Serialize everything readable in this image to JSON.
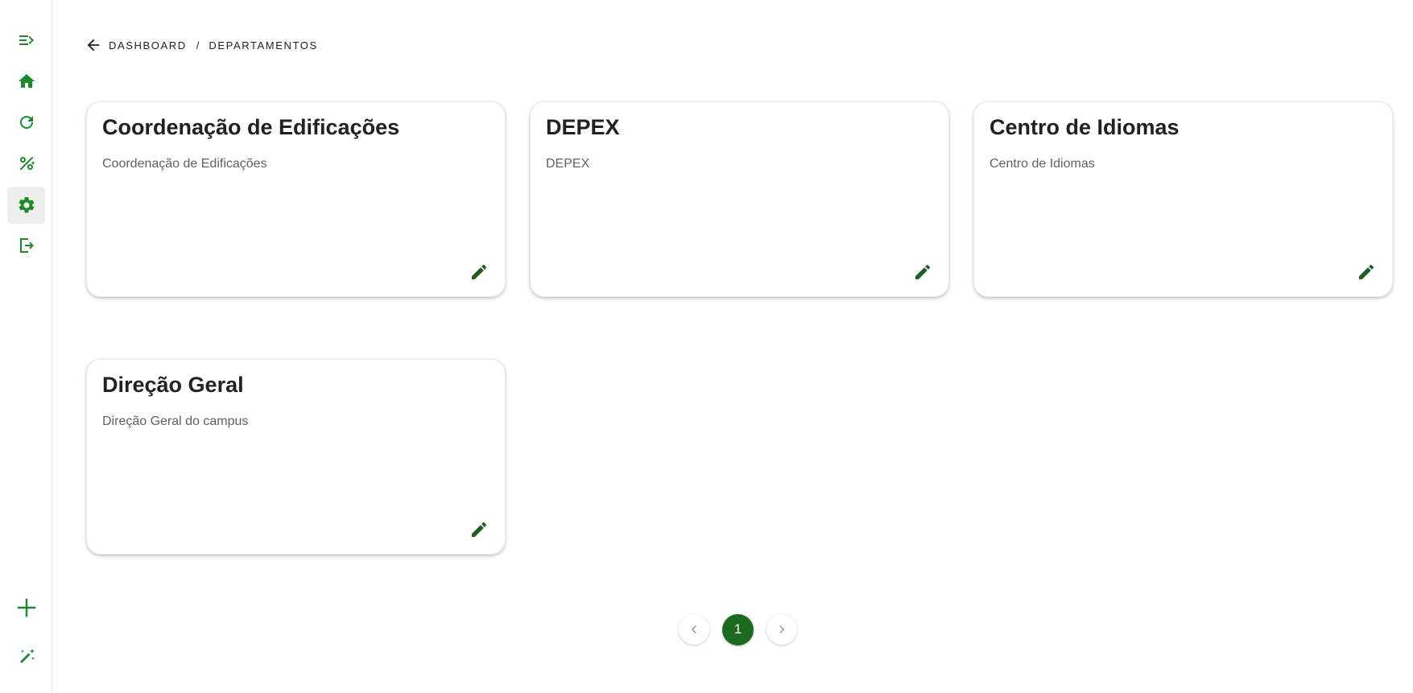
{
  "colors": {
    "accent": "#1b8a2a",
    "accent_dark": "#1a6b1f",
    "edit_icon": "#1a5e20",
    "text": "#212121",
    "muted": "#616161"
  },
  "sidebar": {
    "items": [
      {
        "icon": "menu-open-icon"
      },
      {
        "icon": "home-icon"
      },
      {
        "icon": "refresh-icon"
      },
      {
        "icon": "percent-sparkle-icon"
      },
      {
        "icon": "gear-icon",
        "active": true
      },
      {
        "icon": "logout-icon"
      },
      {
        "icon": "plus-icon"
      },
      {
        "icon": "magic-wand-icon"
      }
    ]
  },
  "breadcrumb": {
    "back_icon": "arrow-left-icon",
    "items": [
      "DASHBOARD",
      "DEPARTAMENTOS"
    ],
    "separator": "/"
  },
  "cards": [
    {
      "title": "Coordenação de Edificações",
      "description": "Coordenação de Edificações",
      "edit_icon": "pencil-icon"
    },
    {
      "title": "DEPEX",
      "description": "DEPEX",
      "edit_icon": "pencil-icon"
    },
    {
      "title": "Centro de Idiomas",
      "description": "Centro de Idiomas",
      "edit_icon": "pencil-icon"
    },
    {
      "title": "Direção Geral",
      "description": "Direção Geral do campus",
      "edit_icon": "pencil-icon"
    }
  ],
  "pagination": {
    "current_page": "1",
    "prev_icon": "chevron-left-icon",
    "next_icon": "chevron-right-icon"
  }
}
